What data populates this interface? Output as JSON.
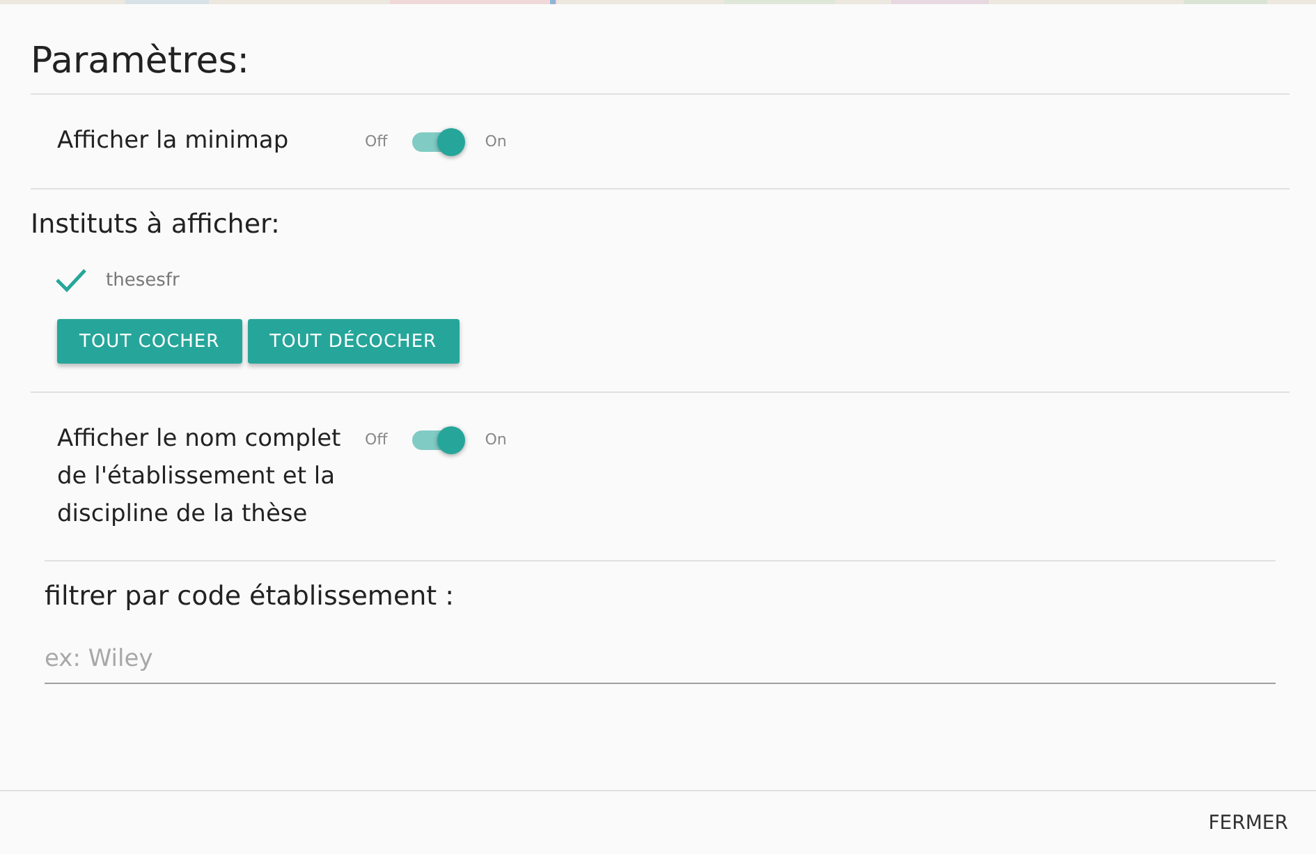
{
  "title": "Paramètres:",
  "minimap": {
    "label": "Afficher la minimap",
    "off_label": "Off",
    "on_label": "On",
    "on": true
  },
  "institutes": {
    "title": "Instituts à afficher:",
    "items": [
      {
        "label": "thesesfr",
        "checked": true
      }
    ],
    "buttons": [
      "TOUT COCHER",
      "TOUT DÉCOCHER"
    ]
  },
  "full_name": {
    "label": "Afficher le nom complet de l'établissement et la discipline de la thèse",
    "off_label": "Off",
    "on_label": "On",
    "on": true
  },
  "filter": {
    "label": "filtrer par code établissement :",
    "placeholder": "ex: Wiley"
  },
  "footer": {
    "button": "FERMER"
  }
}
